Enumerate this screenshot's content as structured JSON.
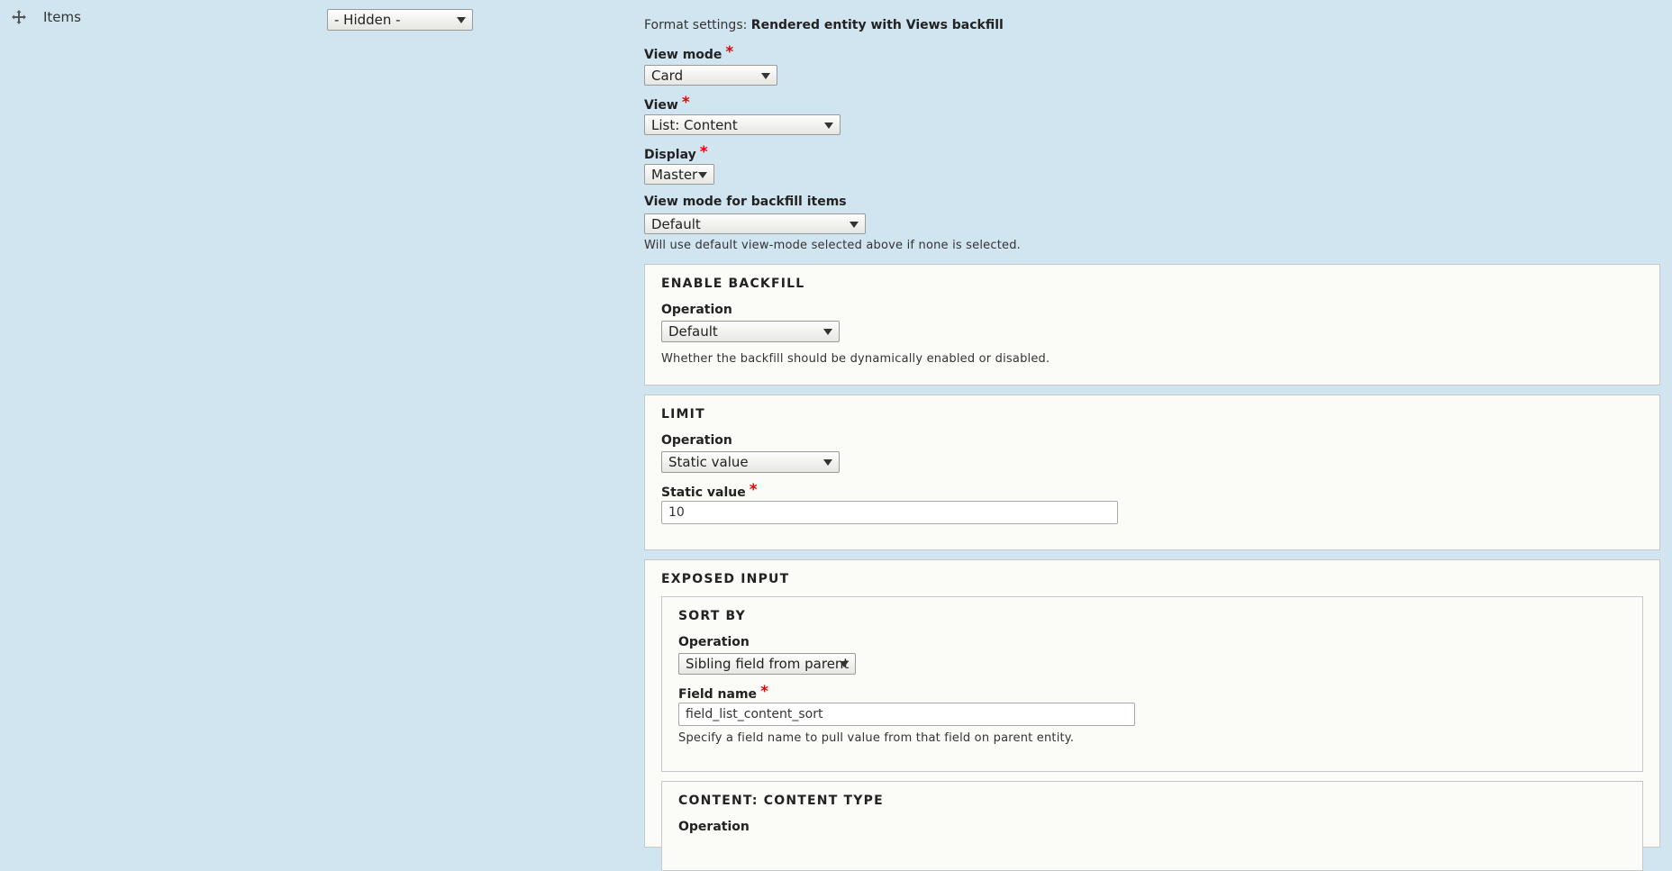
{
  "row": {
    "label": "Items",
    "icon": "move-icon"
  },
  "region_select": {
    "value": "- Hidden -"
  },
  "format_settings": {
    "prefix": "Format settings:",
    "value": "Rendered entity with Views backfill"
  },
  "view_mode": {
    "label": "View mode",
    "value": "Card"
  },
  "view": {
    "label": "View",
    "value": "List: Content"
  },
  "display": {
    "label": "Display",
    "value": "Master"
  },
  "backfill_view_mode": {
    "label": "View mode for backfill items",
    "value": "Default",
    "description": "Will use default view-mode selected above if none is selected."
  },
  "required_marker": "*",
  "enable_backfill": {
    "legend": "ENABLE BACKFILL",
    "operation_label": "Operation",
    "operation_value": "Default",
    "description": "Whether the backfill should be dynamically enabled or disabled."
  },
  "limit": {
    "legend": "LIMIT",
    "operation_label": "Operation",
    "operation_value": "Static value",
    "static_label": "Static value",
    "static_value": "10"
  },
  "exposed_input": {
    "legend": "EXPOSED INPUT",
    "sort_by": {
      "legend": "SORT BY",
      "operation_label": "Operation",
      "operation_value": "Sibling field from parent",
      "field_label": "Field name",
      "field_value": "field_list_content_sort",
      "description": "Specify a field name to pull value from that field on parent entity."
    },
    "content_type": {
      "legend": "CONTENT: CONTENT TYPE",
      "operation_label": "Operation"
    }
  }
}
